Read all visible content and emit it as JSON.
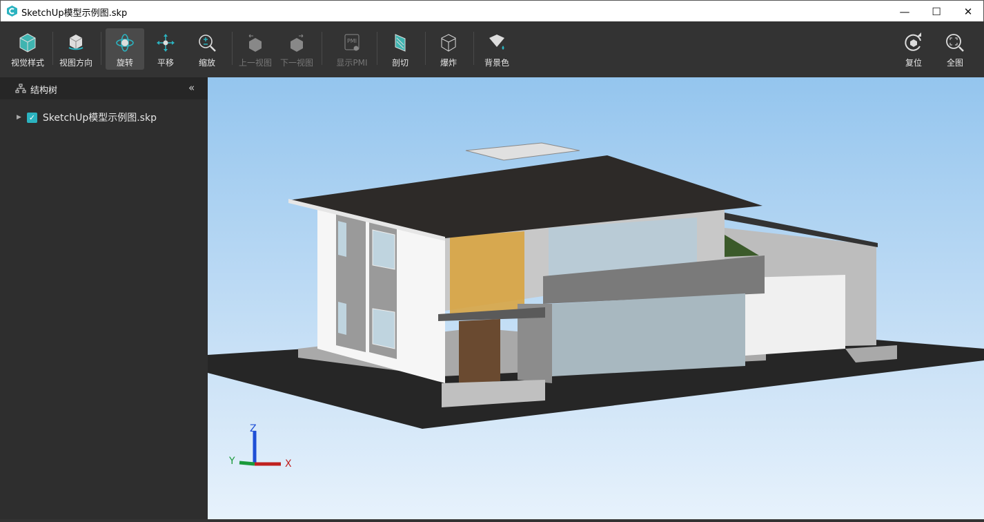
{
  "window": {
    "title": "SketchUp模型示例图.skp",
    "minimize": "—",
    "maximize": "☐",
    "close": "✕"
  },
  "toolbar": {
    "items": [
      {
        "label": "视觉样式",
        "icon": "cube-style-icon"
      },
      {
        "label": "视图方向",
        "icon": "view-orientation-icon"
      },
      {
        "label": "旋转",
        "icon": "rotate-icon"
      },
      {
        "label": "平移",
        "icon": "pan-icon"
      },
      {
        "label": "缩放",
        "icon": "zoom-icon"
      },
      {
        "label": "上一视图",
        "icon": "previous-view-icon"
      },
      {
        "label": "下一视图",
        "icon": "next-view-icon"
      },
      {
        "label": "显示PMI",
        "icon": "pmi-icon"
      },
      {
        "label": "剖切",
        "icon": "section-icon"
      },
      {
        "label": "爆炸",
        "icon": "explode-icon"
      },
      {
        "label": "背景色",
        "icon": "background-color-icon"
      }
    ],
    "right": [
      {
        "label": "复位",
        "icon": "reset-icon"
      },
      {
        "label": "全图",
        "icon": "fit-all-icon"
      }
    ],
    "pmi_text": "PMI"
  },
  "sidebar": {
    "title": "结构树",
    "collapse": "«",
    "tree": [
      {
        "label": "SketchUp模型示例图.skp",
        "checked": true
      }
    ]
  },
  "axes": {
    "x": "X",
    "y": "Y",
    "z": "Z"
  },
  "colors": {
    "accent": "#2bb3c0",
    "toolbar": "#333333"
  }
}
